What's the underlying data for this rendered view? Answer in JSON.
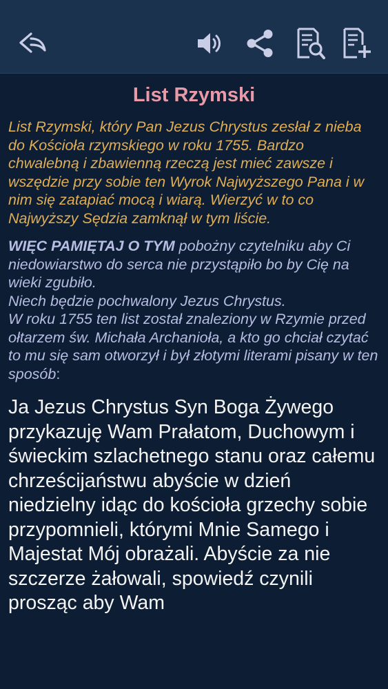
{
  "toolbar": {
    "back_icon": "reply-arrow-icon",
    "audio_icon": "speaker-icon",
    "share_icon": "share-icon",
    "search_icon": "document-search-icon",
    "add_icon": "document-add-icon",
    "icon_color": "#c9cde6",
    "background": "#1a324d"
  },
  "page": {
    "title": "List Rzymski",
    "intro": "List Rzymski, który Pan Jezus Chrystus zesłał z nieba do Kościoła rzymskiego w roku 1755. Bardzo chwalebną i zbawienną rzeczą jest mieć zawsze i wszędzie przy sobie ten Wyrok Najwyższego Pana i w nim się zatapiać mocą i wiarą. Wierzyć w to co Najwyższy Sędzia zamknął w tym liście.",
    "note_strong": "WIĘC PAMIĘTAJ O TYM",
    "note_text": " pobożny czytelniku aby Ci niedowiarstwo do serca nie przystąpiło bo by Cię na wieki zgubiło.",
    "note_line2": "Niech będzie pochwalony Jezus Chrystus.",
    "note_line3": "W roku 1755 ten list został znaleziony w Rzymie przed ołtarzem św. Michała Archanioła, a kto go chciał czytać to mu się sam otworzył i był złotymi literami pisany w ten sposób",
    "note_colon": ":",
    "letter": "Ja Jezus Chrystus Syn Boga Żywego przykazuję Wam Prałatom, Duchowym i świeckim szlachetnego stanu oraz całemu chrześcijaństwu abyście w dzień niedzielny idąc do kościoła grzechy sobie przypomnieli, którymi Mnie Samego i Majestat Mój obrażali. Abyście za nie szczerze żałowali, spowiedź czynili prosząc aby Wam"
  },
  "colors": {
    "background": "#0d1d33",
    "title": "#e89aa8",
    "intro": "#e0ae55",
    "note": "#b7bde3",
    "letter": "#f4f4f4"
  }
}
